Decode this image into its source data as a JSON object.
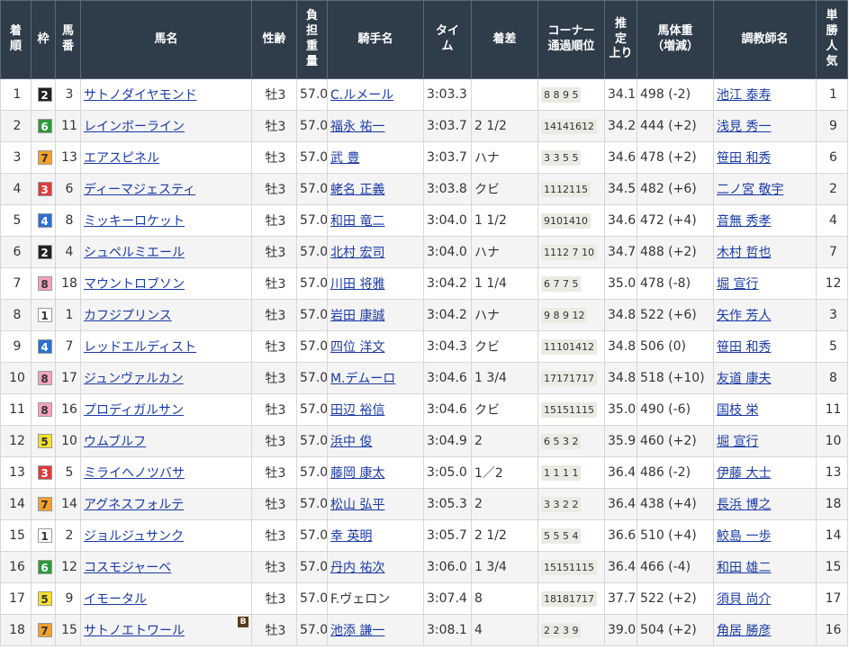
{
  "headers": {
    "rank": "着\n順",
    "waku": "枠",
    "umaban": "馬\n番",
    "horse": "馬名",
    "sexage": "性齢",
    "weight": "負\n担\n重\n量",
    "jockey": "騎手名",
    "time": "タイ\nム",
    "margin": "着差",
    "corner": "コーナー\n通過順位",
    "last3f": "推\n定\n上り",
    "bodyweight": "馬体重\n（増減）",
    "trainer": "調教師名",
    "popularity": "単\n勝\n人\n気"
  },
  "waku_colors": {
    "1": {
      "bg": "#ffffff",
      "fg": "#333333"
    },
    "2": {
      "bg": "#222222",
      "fg": "#ffffff"
    },
    "3": {
      "bg": "#e03a3a",
      "fg": "#ffffff"
    },
    "4": {
      "bg": "#2a6fd6",
      "fg": "#ffffff"
    },
    "5": {
      "bg": "#f5e12a",
      "fg": "#333333"
    },
    "6": {
      "bg": "#2c9a3a",
      "fg": "#ffffff"
    },
    "7": {
      "bg": "#f2a12a",
      "fg": "#333333"
    },
    "8": {
      "bg": "#f5a3bd",
      "fg": "#333333"
    }
  },
  "rows": [
    {
      "rank": "1",
      "waku": "2",
      "umaban": "3",
      "horse": "サトノダイヤモンド",
      "blinker": "",
      "sexage": "牡3",
      "weight": "57.0",
      "jockey": "C.ルメール",
      "jockey_link": true,
      "time": "3:03.3",
      "margin": "",
      "corner": "8 8 9 5",
      "last3f": "34.1",
      "bodyweight": "498 (-2)",
      "trainer": "池江 泰寿",
      "popularity": "1"
    },
    {
      "rank": "2",
      "waku": "6",
      "umaban": "11",
      "horse": "レインボーライン",
      "blinker": "",
      "sexage": "牡3",
      "weight": "57.0",
      "jockey": "福永 祐一",
      "jockey_link": true,
      "time": "3:03.7",
      "margin": "2 1/2",
      "corner": "14141612",
      "last3f": "34.2",
      "bodyweight": "444 (+2)",
      "trainer": "浅見 秀一",
      "popularity": "9"
    },
    {
      "rank": "3",
      "waku": "7",
      "umaban": "13",
      "horse": "エアスピネル",
      "blinker": "",
      "sexage": "牡3",
      "weight": "57.0",
      "jockey": "武 豊",
      "jockey_link": true,
      "time": "3:03.7",
      "margin": "ハナ",
      "corner": "3 3 5 5",
      "last3f": "34.6",
      "bodyweight": "478 (+2)",
      "trainer": "笹田 和秀",
      "popularity": "6"
    },
    {
      "rank": "4",
      "waku": "3",
      "umaban": "6",
      "horse": "ディーマジェスティ",
      "blinker": "",
      "sexage": "牡3",
      "weight": "57.0",
      "jockey": "蛯名 正義",
      "jockey_link": true,
      "time": "3:03.8",
      "margin": "クビ",
      "corner": "1112115",
      "last3f": "34.5",
      "bodyweight": "482 (+6)",
      "trainer": "二ノ宮 敬宇",
      "popularity": "2"
    },
    {
      "rank": "5",
      "waku": "4",
      "umaban": "8",
      "horse": "ミッキーロケット",
      "blinker": "",
      "sexage": "牡3",
      "weight": "57.0",
      "jockey": "和田 竜二",
      "jockey_link": true,
      "time": "3:04.0",
      "margin": "1 1/2",
      "corner": "9101410",
      "last3f": "34.6",
      "bodyweight": "472 (+4)",
      "trainer": "音無 秀孝",
      "popularity": "4"
    },
    {
      "rank": "6",
      "waku": "2",
      "umaban": "4",
      "horse": "シュペルミエール",
      "blinker": "",
      "sexage": "牡3",
      "weight": "57.0",
      "jockey": "北村 宏司",
      "jockey_link": true,
      "time": "3:04.0",
      "margin": "ハナ",
      "corner": "1112 7 10",
      "last3f": "34.7",
      "bodyweight": "488 (+2)",
      "trainer": "木村 哲也",
      "popularity": "7"
    },
    {
      "rank": "7",
      "waku": "8",
      "umaban": "18",
      "horse": "マウントロブソン",
      "blinker": "",
      "sexage": "牡3",
      "weight": "57.0",
      "jockey": "川田 将雅",
      "jockey_link": true,
      "time": "3:04.2",
      "margin": "1 1/4",
      "corner": "6 7 7 5",
      "last3f": "35.0",
      "bodyweight": "478 (-8)",
      "trainer": "堀 宣行",
      "popularity": "12"
    },
    {
      "rank": "8",
      "waku": "1",
      "umaban": "1",
      "horse": "カフジプリンス",
      "blinker": "",
      "sexage": "牡3",
      "weight": "57.0",
      "jockey": "岩田 康誠",
      "jockey_link": true,
      "time": "3:04.2",
      "margin": "ハナ",
      "corner": "9 8 9 12",
      "last3f": "34.8",
      "bodyweight": "522 (+6)",
      "trainer": "矢作 芳人",
      "popularity": "3"
    },
    {
      "rank": "9",
      "waku": "4",
      "umaban": "7",
      "horse": "レッドエルディスト",
      "blinker": "",
      "sexage": "牡3",
      "weight": "57.0",
      "jockey": "四位 洋文",
      "jockey_link": true,
      "time": "3:04.3",
      "margin": "クビ",
      "corner": "11101412",
      "last3f": "34.8",
      "bodyweight": "506 (0)",
      "trainer": "笹田 和秀",
      "popularity": "5"
    },
    {
      "rank": "10",
      "waku": "8",
      "umaban": "17",
      "horse": "ジュンヴァルカン",
      "blinker": "",
      "sexage": "牡3",
      "weight": "57.0",
      "jockey": "M.デムーロ",
      "jockey_link": true,
      "time": "3:04.6",
      "margin": "1 3/4",
      "corner": "17171717",
      "last3f": "34.8",
      "bodyweight": "518 (+10)",
      "trainer": "友道 康夫",
      "popularity": "8"
    },
    {
      "rank": "11",
      "waku": "8",
      "umaban": "16",
      "horse": "プロディガルサン",
      "blinker": "",
      "sexage": "牡3",
      "weight": "57.0",
      "jockey": "田辺 裕信",
      "jockey_link": true,
      "time": "3:04.6",
      "margin": "クビ",
      "corner": "15151115",
      "last3f": "35.0",
      "bodyweight": "490 (-6)",
      "trainer": "国枝 栄",
      "popularity": "11"
    },
    {
      "rank": "12",
      "waku": "5",
      "umaban": "10",
      "horse": "ウムブルフ",
      "blinker": "",
      "sexage": "牡3",
      "weight": "57.0",
      "jockey": "浜中 俊",
      "jockey_link": true,
      "time": "3:04.9",
      "margin": "2",
      "corner": "6 5 3 2",
      "last3f": "35.9",
      "bodyweight": "460 (+2)",
      "trainer": "堀 宣行",
      "popularity": "10"
    },
    {
      "rank": "13",
      "waku": "3",
      "umaban": "5",
      "horse": "ミライヘノツバサ",
      "blinker": "",
      "sexage": "牡3",
      "weight": "57.0",
      "jockey": "藤岡 康太",
      "jockey_link": true,
      "time": "3:05.0",
      "margin": "1／2",
      "corner": "1 1 1 1",
      "last3f": "36.4",
      "bodyweight": "486 (-2)",
      "trainer": "伊藤 大士",
      "popularity": "13"
    },
    {
      "rank": "14",
      "waku": "7",
      "umaban": "14",
      "horse": "アグネスフォルテ",
      "blinker": "",
      "sexage": "牡3",
      "weight": "57.0",
      "jockey": "松山 弘平",
      "jockey_link": true,
      "time": "3:05.3",
      "margin": "2",
      "corner": "3 3 2 2",
      "last3f": "36.4",
      "bodyweight": "438 (+4)",
      "trainer": "長浜 博之",
      "popularity": "18"
    },
    {
      "rank": "15",
      "waku": "1",
      "umaban": "2",
      "horse": "ジョルジュサンク",
      "blinker": "",
      "sexage": "牡3",
      "weight": "57.0",
      "jockey": "幸 英明",
      "jockey_link": true,
      "time": "3:05.7",
      "margin": "2 1/2",
      "corner": "5 5 5 4",
      "last3f": "36.6",
      "bodyweight": "510 (+4)",
      "trainer": "鮫島 一歩",
      "popularity": "14"
    },
    {
      "rank": "16",
      "waku": "6",
      "umaban": "12",
      "horse": "コスモジャーベ",
      "blinker": "",
      "sexage": "牡3",
      "weight": "57.0",
      "jockey": "丹内 祐次",
      "jockey_link": true,
      "time": "3:06.0",
      "margin": "1 3/4",
      "corner": "15151115",
      "last3f": "36.4",
      "bodyweight": "466 (-4)",
      "trainer": "和田 雄二",
      "popularity": "15"
    },
    {
      "rank": "17",
      "waku": "5",
      "umaban": "9",
      "horse": "イモータル",
      "blinker": "",
      "sexage": "牡3",
      "weight": "57.0",
      "jockey": "F.ヴェロン",
      "jockey_link": false,
      "time": "3:07.4",
      "margin": "8",
      "corner": "18181717",
      "last3f": "37.7",
      "bodyweight": "522 (+2)",
      "trainer": "須貝 尚介",
      "popularity": "17"
    },
    {
      "rank": "18",
      "waku": "7",
      "umaban": "15",
      "horse": "サトノエトワール",
      "blinker": "B",
      "sexage": "牡3",
      "weight": "57.0",
      "jockey": "池添 謙一",
      "jockey_link": true,
      "time": "3:08.1",
      "margin": "4",
      "corner": "2 2 3 9",
      "last3f": "39.0",
      "bodyweight": "504 (+2)",
      "trainer": "角居 勝彦",
      "popularity": "16"
    }
  ]
}
